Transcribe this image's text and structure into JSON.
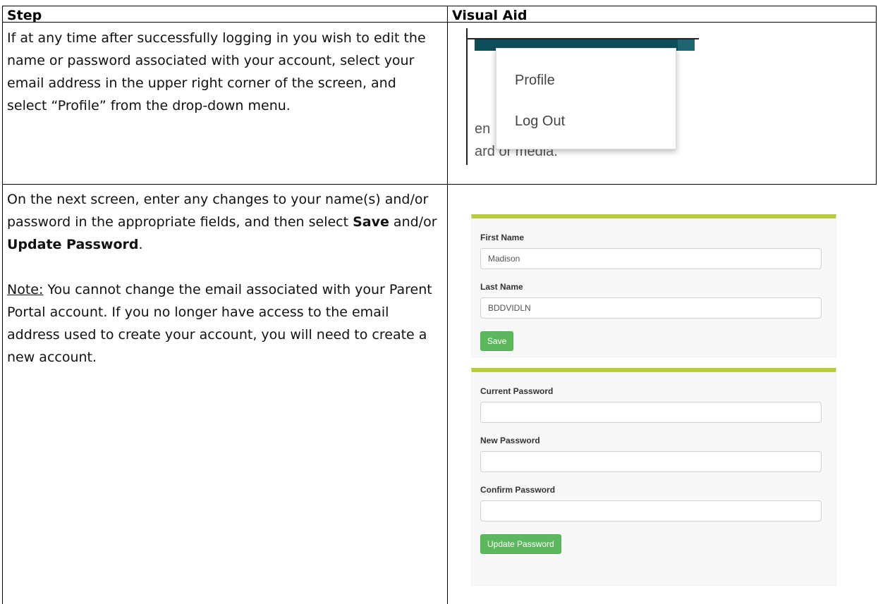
{
  "table": {
    "headers": {
      "step": "Step",
      "visual_aid": "Visual Aid"
    },
    "rows": [
      {
        "step_text": "If at any time after successfully logging in you wish to edit the name or password associated with your account, select your email address in the upper right corner of the screen, and select “Profile” from the drop-down menu."
      },
      {
        "step_parts": {
          "p1_a": "On the next screen, enter any changes to your name(s) and/or password in the appropriate fields, and then select ",
          "p1_save": "Save",
          "p1_b": " and/or ",
          "p1_update": "Update Password",
          "p1_c": ".",
          "note_label": "Note:",
          "note_text": " You cannot change the email associated with your Parent Portal account. If you no longer have access to the email address used to create your account, you will need to create a new account."
        }
      }
    ]
  },
  "dropdown_aid": {
    "menu_items": [
      "Profile",
      "Log Out"
    ],
    "background_fragments": [
      "en",
      "ard or media."
    ]
  },
  "profile_aid": {
    "name_panel": {
      "first_name_label": "First Name",
      "first_name_value": "Madison",
      "last_name_label": "Last Name",
      "last_name_value": "BDDVIDLN",
      "save_label": "Save"
    },
    "password_panel": {
      "current_label": "Current Password",
      "new_label": "New Password",
      "confirm_label": "Confirm Password",
      "update_label": "Update Password"
    },
    "colors": {
      "accent_bar": "#b9cc3c",
      "button_green": "#5cb85c",
      "nav_teal": "#0d4e5a"
    }
  }
}
